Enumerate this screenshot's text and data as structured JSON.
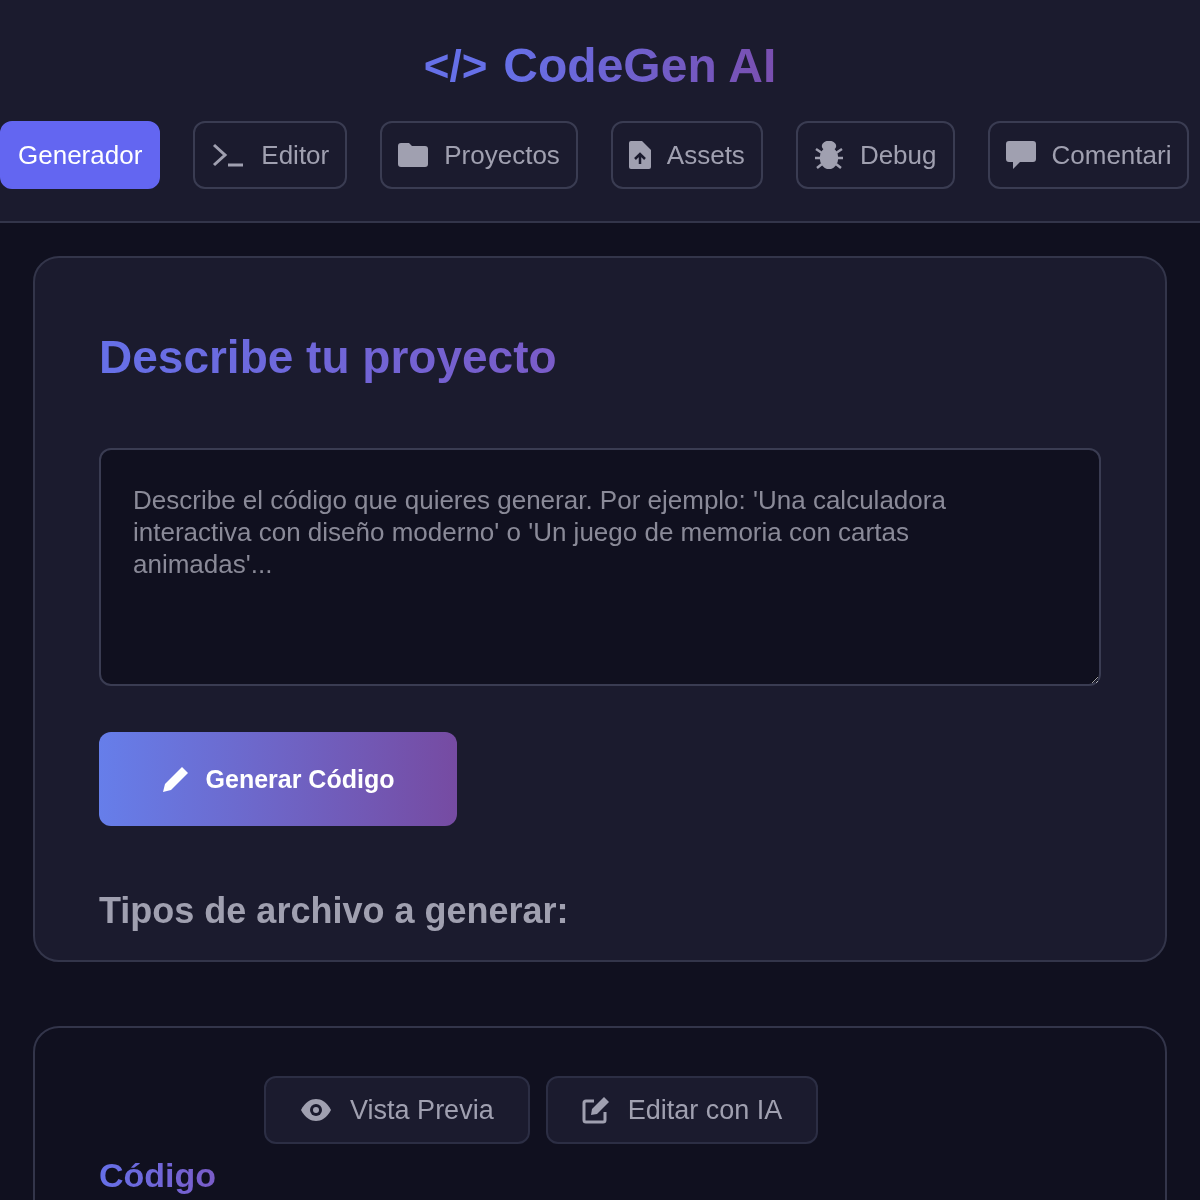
{
  "header": {
    "logo_mark": "</>",
    "title": "CodeGen AI"
  },
  "tabs": [
    {
      "label": "Generador",
      "selected": true
    },
    {
      "label": "Editor",
      "selected": false
    },
    {
      "label": "Proyectos",
      "selected": false
    },
    {
      "label": "Assets",
      "selected": false
    },
    {
      "label": "Debug",
      "selected": false
    },
    {
      "label": "Comentari",
      "selected": false
    }
  ],
  "generator": {
    "heading": "Describe tu proyecto",
    "placeholder": "Describe el código que quieres generar. Por ejemplo: 'Una calculadora interactiva con diseño moderno' o 'Un juego de memoria con cartas animadas'...",
    "button": "Generar Código",
    "file_types_heading": "Tipos de archivo a generar:"
  },
  "output": {
    "heading": "Código",
    "actions": [
      {
        "label": "Vista Previa"
      },
      {
        "label": "Editar con IA"
      }
    ]
  }
}
